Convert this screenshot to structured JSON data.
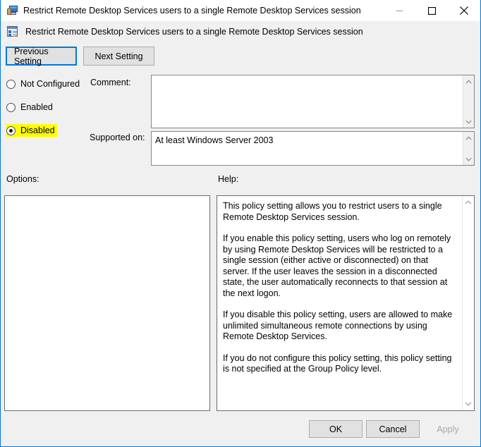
{
  "window": {
    "title": "Restrict Remote Desktop Services users to a single Remote Desktop Services session",
    "icon": "remote-desktop-monitor-icon",
    "border_color": "#0078d7",
    "controls": {
      "minimize": "minimize-icon",
      "maximize": "maximize-icon",
      "close": "close-icon"
    }
  },
  "header": {
    "icon": "group-policy-setting-icon",
    "title": "Restrict Remote Desktop Services users to a single Remote Desktop Services session"
  },
  "nav": {
    "previous_label": "Previous Setting",
    "next_label": "Next Setting",
    "focused": "previous"
  },
  "state": {
    "options": [
      {
        "id": "not-configured",
        "label": "Not Configured",
        "selected": false,
        "highlighted": false
      },
      {
        "id": "enabled",
        "label": "Enabled",
        "selected": false,
        "highlighted": false
      },
      {
        "id": "disabled",
        "label": "Disabled",
        "selected": true,
        "highlighted": true
      }
    ],
    "highlight_color": "#ffff00"
  },
  "comment": {
    "label": "Comment:",
    "value": "",
    "placeholder": ""
  },
  "supported": {
    "label": "Supported on:",
    "value": "At least Windows Server 2003"
  },
  "options_panel": {
    "label": "Options:",
    "content": ""
  },
  "help_panel": {
    "label": "Help:",
    "paragraphs": [
      "This policy setting allows you to restrict users to a single Remote Desktop Services session.",
      "If you enable this policy setting, users who log on remotely by using Remote Desktop Services will be restricted to a single session (either active or disconnected) on that server. If the user leaves the session in a disconnected state, the user automatically reconnects to that session at the next logon.",
      "If you disable this policy setting, users are allowed to make unlimited simultaneous remote connections by using Remote Desktop Services.",
      "If you do not configure this policy setting,  this policy setting is not specified at the Group Policy level."
    ]
  },
  "footer": {
    "ok_label": "OK",
    "cancel_label": "Cancel",
    "apply_label": "Apply",
    "apply_enabled": false
  }
}
